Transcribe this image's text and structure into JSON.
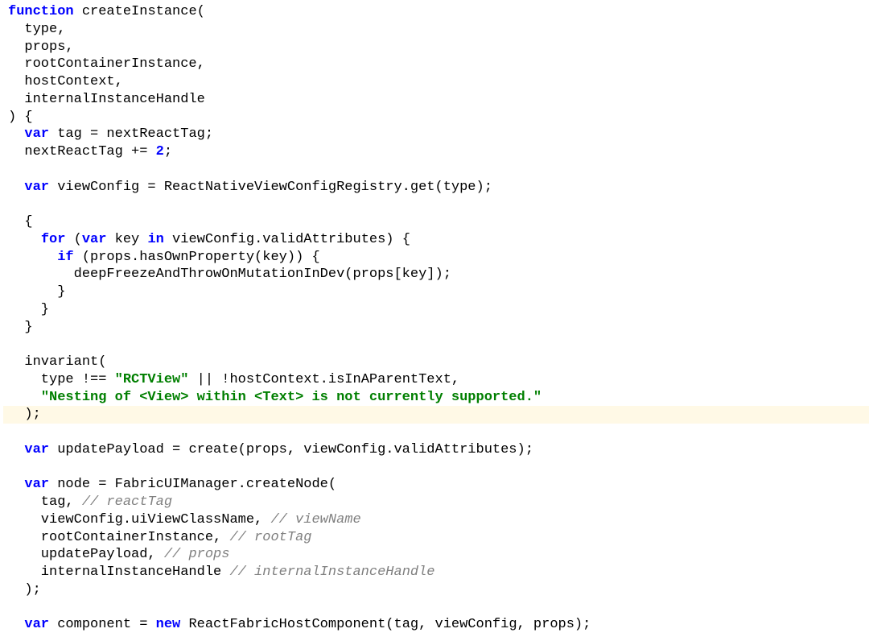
{
  "code": {
    "lines": [
      {
        "highlighted": false,
        "segments": [
          {
            "cls": "kw",
            "text": "function"
          },
          {
            "cls": "",
            "text": " createInstance("
          }
        ]
      },
      {
        "highlighted": false,
        "segments": [
          {
            "cls": "",
            "text": "  type,"
          }
        ]
      },
      {
        "highlighted": false,
        "segments": [
          {
            "cls": "",
            "text": "  props,"
          }
        ]
      },
      {
        "highlighted": false,
        "segments": [
          {
            "cls": "",
            "text": "  rootContainerInstance,"
          }
        ]
      },
      {
        "highlighted": false,
        "segments": [
          {
            "cls": "",
            "text": "  hostContext,"
          }
        ]
      },
      {
        "highlighted": false,
        "segments": [
          {
            "cls": "",
            "text": "  internalInstanceHandle"
          }
        ]
      },
      {
        "highlighted": false,
        "segments": [
          {
            "cls": "",
            "text": ") {"
          }
        ]
      },
      {
        "highlighted": false,
        "segments": [
          {
            "cls": "",
            "text": "  "
          },
          {
            "cls": "kw",
            "text": "var"
          },
          {
            "cls": "",
            "text": " tag = nextReactTag;"
          }
        ]
      },
      {
        "highlighted": false,
        "segments": [
          {
            "cls": "",
            "text": "  nextReactTag += "
          },
          {
            "cls": "num",
            "text": "2"
          },
          {
            "cls": "",
            "text": ";"
          }
        ]
      },
      {
        "highlighted": false,
        "segments": [
          {
            "cls": "",
            "text": ""
          }
        ]
      },
      {
        "highlighted": false,
        "segments": [
          {
            "cls": "",
            "text": "  "
          },
          {
            "cls": "kw",
            "text": "var"
          },
          {
            "cls": "",
            "text": " viewConfig = ReactNativeViewConfigRegistry.get(type);"
          }
        ]
      },
      {
        "highlighted": false,
        "segments": [
          {
            "cls": "",
            "text": ""
          }
        ]
      },
      {
        "highlighted": false,
        "segments": [
          {
            "cls": "",
            "text": "  {"
          }
        ]
      },
      {
        "highlighted": false,
        "segments": [
          {
            "cls": "",
            "text": "    "
          },
          {
            "cls": "kw",
            "text": "for"
          },
          {
            "cls": "",
            "text": " ("
          },
          {
            "cls": "kw",
            "text": "var"
          },
          {
            "cls": "",
            "text": " key "
          },
          {
            "cls": "kw",
            "text": "in"
          },
          {
            "cls": "",
            "text": " viewConfig.validAttributes) {"
          }
        ]
      },
      {
        "highlighted": false,
        "segments": [
          {
            "cls": "",
            "text": "      "
          },
          {
            "cls": "kw",
            "text": "if"
          },
          {
            "cls": "",
            "text": " (props.hasOwnProperty(key)) {"
          }
        ]
      },
      {
        "highlighted": false,
        "segments": [
          {
            "cls": "",
            "text": "        deepFreezeAndThrowOnMutationInDev(props[key]);"
          }
        ]
      },
      {
        "highlighted": false,
        "segments": [
          {
            "cls": "",
            "text": "      }"
          }
        ]
      },
      {
        "highlighted": false,
        "segments": [
          {
            "cls": "",
            "text": "    }"
          }
        ]
      },
      {
        "highlighted": false,
        "segments": [
          {
            "cls": "",
            "text": "  }"
          }
        ]
      },
      {
        "highlighted": false,
        "segments": [
          {
            "cls": "",
            "text": ""
          }
        ]
      },
      {
        "highlighted": false,
        "segments": [
          {
            "cls": "",
            "text": "  invariant("
          }
        ]
      },
      {
        "highlighted": false,
        "segments": [
          {
            "cls": "",
            "text": "    type !== "
          },
          {
            "cls": "str",
            "text": "\"RCTView\""
          },
          {
            "cls": "",
            "text": " || !hostContext.isInAParentText,"
          }
        ]
      },
      {
        "highlighted": false,
        "segments": [
          {
            "cls": "",
            "text": "    "
          },
          {
            "cls": "str",
            "text": "\"Nesting of <View> within <Text> is not currently supported.\""
          }
        ]
      },
      {
        "highlighted": true,
        "segments": [
          {
            "cls": "",
            "text": "  );"
          }
        ]
      },
      {
        "highlighted": false,
        "segments": [
          {
            "cls": "",
            "text": ""
          }
        ]
      },
      {
        "highlighted": false,
        "segments": [
          {
            "cls": "",
            "text": "  "
          },
          {
            "cls": "kw",
            "text": "var"
          },
          {
            "cls": "",
            "text": " updatePayload = create(props, viewConfig.validAttributes);"
          }
        ]
      },
      {
        "highlighted": false,
        "segments": [
          {
            "cls": "",
            "text": ""
          }
        ]
      },
      {
        "highlighted": false,
        "segments": [
          {
            "cls": "",
            "text": "  "
          },
          {
            "cls": "kw",
            "text": "var"
          },
          {
            "cls": "",
            "text": " node = FabricUIManager.createNode("
          }
        ]
      },
      {
        "highlighted": false,
        "segments": [
          {
            "cls": "",
            "text": "    tag, "
          },
          {
            "cls": "cmt",
            "text": "// reactTag"
          }
        ]
      },
      {
        "highlighted": false,
        "segments": [
          {
            "cls": "",
            "text": "    viewConfig.uiViewClassName, "
          },
          {
            "cls": "cmt",
            "text": "// viewName"
          }
        ]
      },
      {
        "highlighted": false,
        "segments": [
          {
            "cls": "",
            "text": "    rootContainerInstance, "
          },
          {
            "cls": "cmt",
            "text": "// rootTag"
          }
        ]
      },
      {
        "highlighted": false,
        "segments": [
          {
            "cls": "",
            "text": "    updatePayload, "
          },
          {
            "cls": "cmt",
            "text": "// props"
          }
        ]
      },
      {
        "highlighted": false,
        "segments": [
          {
            "cls": "",
            "text": "    internalInstanceHandle "
          },
          {
            "cls": "cmt",
            "text": "// internalInstanceHandle"
          }
        ]
      },
      {
        "highlighted": false,
        "segments": [
          {
            "cls": "",
            "text": "  );"
          }
        ]
      },
      {
        "highlighted": false,
        "segments": [
          {
            "cls": "",
            "text": ""
          }
        ]
      },
      {
        "highlighted": false,
        "segments": [
          {
            "cls": "",
            "text": "  "
          },
          {
            "cls": "kw",
            "text": "var"
          },
          {
            "cls": "",
            "text": " component = "
          },
          {
            "cls": "new",
            "text": "new"
          },
          {
            "cls": "",
            "text": " ReactFabricHostComponent(tag, viewConfig, props);"
          }
        ]
      }
    ]
  }
}
